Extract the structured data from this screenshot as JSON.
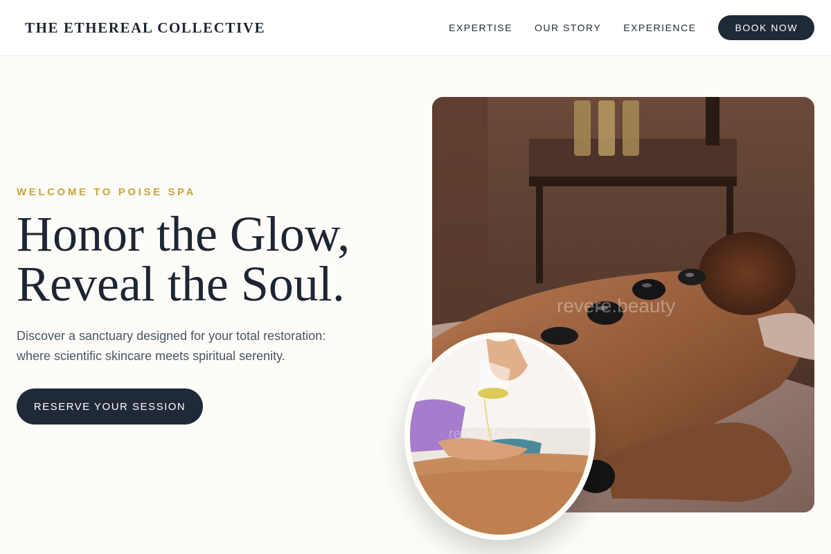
{
  "header": {
    "brand": "THE ETHEREAL COLLECTIVE",
    "nav": [
      "EXPERTISE",
      "OUR STORY",
      "EXPERIENCE"
    ],
    "book_label": "BOOK NOW"
  },
  "hero": {
    "eyebrow": "WELCOME TO POISE SPA",
    "headline": [
      "Honor the Glow,",
      "Reveal the Soul."
    ],
    "description": [
      "Discover a sanctuary designed for your total restoration:",
      "where scientific skincare meets spiritual serenity."
    ],
    "cta_label": "RESERVE YOUR SESSION"
  },
  "images": {
    "watermark_main": "revere.beauty",
    "watermark_inset": "revere.beauty"
  },
  "colors": {
    "accent_gold": "#c9a43a",
    "navy": "#1f2937",
    "background": "#fdfcf8"
  }
}
